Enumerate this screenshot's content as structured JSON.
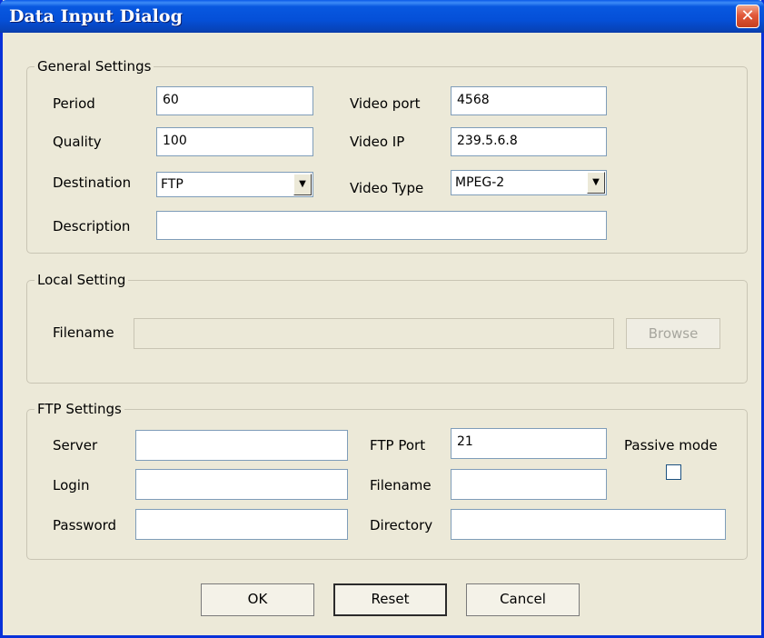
{
  "window": {
    "title": "Data Input Dialog",
    "close_glyph": "✕"
  },
  "general": {
    "group_label": "General Settings",
    "period_label": "Period",
    "period_value": "60",
    "quality_label": "Quality",
    "quality_value": "100",
    "destination_label": "Destination",
    "destination_value": "FTP",
    "description_label": "Description",
    "description_value": "",
    "video_port_label": "Video port",
    "video_port_value": "4568",
    "video_ip_label": "Video IP",
    "video_ip_value": "239.5.6.8",
    "video_type_label": "Video Type",
    "video_type_value": "MPEG-2",
    "dropdown_glyph": "▼"
  },
  "local": {
    "group_label": "Local Setting",
    "filename_label": "Filename",
    "filename_value": "",
    "browse_label": "Browse"
  },
  "ftp": {
    "group_label": "FTP Settings",
    "server_label": "Server",
    "server_value": "",
    "login_label": "Login",
    "login_value": "",
    "password_label": "Password",
    "password_value": "",
    "port_label": "FTP Port",
    "port_value": "21",
    "filename_label": "Filename",
    "filename_value": "",
    "directory_label": "Directory",
    "directory_value": "",
    "passive_label": "Passive mode",
    "passive_checked": false
  },
  "buttons": {
    "ok_label": "OK",
    "reset_label": "Reset",
    "cancel_label": "Cancel"
  }
}
